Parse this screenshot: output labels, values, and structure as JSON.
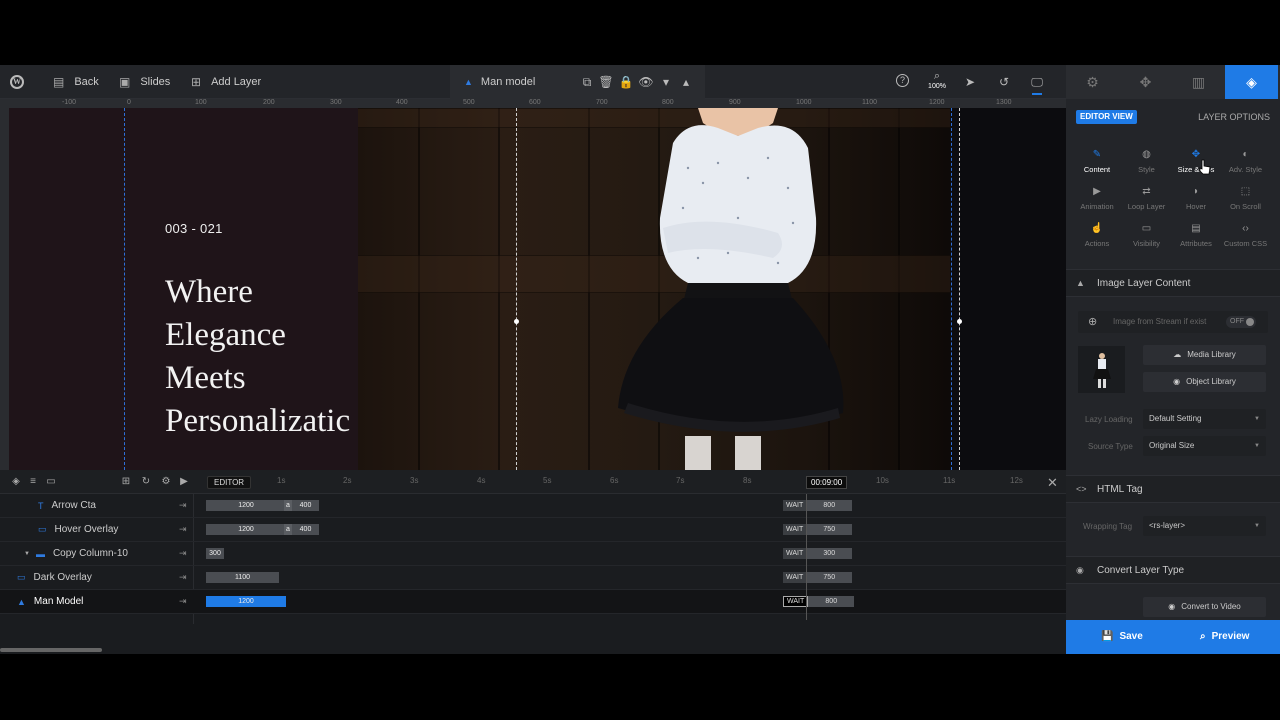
{
  "toolbar": {
    "back": "Back",
    "slides": "Slides",
    "add_layer": "Add Layer",
    "layer_name": "Man model",
    "zoom": "100%"
  },
  "ruler_marks": [
    "-100",
    "0",
    "100",
    "200",
    "300",
    "400",
    "500",
    "600",
    "700",
    "800",
    "900",
    "1000",
    "1100",
    "1200",
    "1300"
  ],
  "canvas": {
    "eyebrow": "003 - 021",
    "headline": "Where\nElegance\nMeets\nPersonalizatic"
  },
  "timeline": {
    "editor_label": "EDITOR",
    "ticks": [
      "1s",
      "2s",
      "3s",
      "4s",
      "5s",
      "6s",
      "7s",
      "8s",
      "10s",
      "11s",
      "12s"
    ],
    "current_time": "00:09:00",
    "rows": [
      {
        "label": "Arrow Cta",
        "icon": "text-icon",
        "bar": "1200",
        "extra": "400",
        "wait": "800"
      },
      {
        "label": "Hover Overlay",
        "icon": "shape-icon",
        "bar": "1200",
        "extra": "400",
        "wait": "750"
      },
      {
        "label": "Copy Column-10",
        "icon": "folder-icon",
        "bar": "300",
        "extra": "",
        "wait": "300"
      },
      {
        "label": "Dark Overlay",
        "icon": "shape-icon",
        "bar": "1100",
        "extra": "",
        "wait": "750"
      },
      {
        "label": "Man Model",
        "icon": "image-icon",
        "bar": "1200",
        "extra": "",
        "wait": "800"
      }
    ],
    "wait_label": "WAIT",
    "split_mark": "a"
  },
  "panel": {
    "editor_view": "EDITOR VIEW",
    "layer_options": "LAYER OPTIONS",
    "options": [
      {
        "label": "Content",
        "icon": "pencil-icon"
      },
      {
        "label": "Style",
        "icon": "palette-icon"
      },
      {
        "label": "Size & Pos",
        "icon": "move-icon"
      },
      {
        "label": "Adv. Style",
        "icon": "contrast-icon"
      },
      {
        "label": "Animation",
        "icon": "play-icon"
      },
      {
        "label": "Loop Layer",
        "icon": "loop-icon"
      },
      {
        "label": "Hover",
        "icon": "mouse-icon"
      },
      {
        "label": "On Scroll",
        "icon": "scroll-icon"
      },
      {
        "label": "Actions",
        "icon": "hand-icon"
      },
      {
        "label": "Visibility",
        "icon": "monitor-icon"
      },
      {
        "label": "Attributes",
        "icon": "file-icon"
      },
      {
        "label": "Custom CSS",
        "icon": "code-icon"
      }
    ],
    "image_section": "Image Layer Content",
    "stream_label": "Image from Stream if exist",
    "stream_toggle": "OFF",
    "media_library": "Media Library",
    "object_library": "Object Library",
    "lazy_label": "Lazy Loading",
    "lazy_value": "Default Setting",
    "source_label": "Source Type",
    "source_value": "Original Size",
    "html_section": "HTML Tag",
    "wrap_label": "Wrapping Tag",
    "wrap_value": "<rs-layer>",
    "convert_section": "Convert Layer Type",
    "convert_button": "Convert to Video",
    "save": "Save",
    "preview": "Preview"
  },
  "colors": {
    "accent": "#1f7be6",
    "panel_bg": "#232529",
    "canvas_left": "#1f1419"
  }
}
